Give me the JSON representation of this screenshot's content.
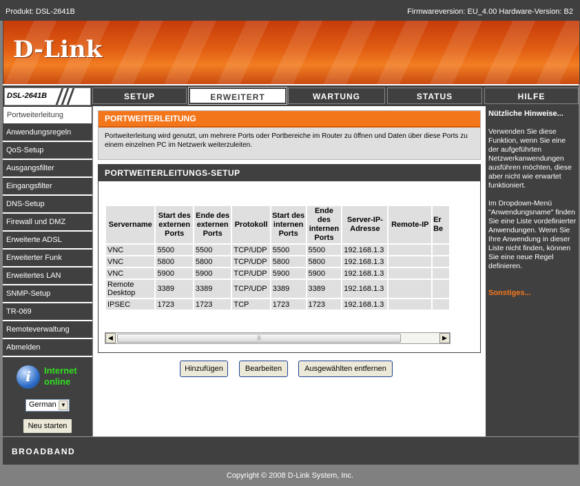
{
  "topbar": {
    "product": "Produkt: DSL-2641B",
    "firmware": "Firmwareversion: EU_4.00 Hardware-Version: B2"
  },
  "brand": {
    "logo": "D-Link",
    "model": "DSL-2641B",
    "footer": "BROADBAND",
    "copyright": "Copyright © 2008 D-Link System, Inc."
  },
  "tabs": [
    "SETUP",
    "ERWEITERT",
    "WARTUNG",
    "STATUS",
    "HILFE"
  ],
  "active_tab": "ERWEITERT",
  "sidebar": {
    "items": [
      "Portweiterleitung",
      "Anwendungsregeln",
      "QoS-Setup",
      "Ausgangsfilter",
      "Eingangsfilter",
      "DNS-Setup",
      "Firewall und DMZ",
      "Erweiterte ADSL",
      "Erweiterter Funk",
      "Erweitertes LAN",
      "SNMP-Setup",
      "TR-069",
      "Remoteverwaltung",
      "Abmelden"
    ],
    "status_icon": "i",
    "status_line1": "Internet",
    "status_line2": "online",
    "language": "German",
    "restart": "Neu starten"
  },
  "section1": {
    "title": "PORTWEITERLEITUNG",
    "description": "Portweiterleitung wird genutzt, um mehrere Ports oder Portbereiche im Router zu öffnen und Daten über diese Ports zu einem einzelnen PC im Netzwerk weiterzuleiten."
  },
  "section2": {
    "title": "PORTWEITERLEITUNGS-SETUP",
    "columns": [
      "Servername",
      "Start des externen Ports",
      "Ende des externen Ports",
      "Protokoll",
      "Start des internen Ports",
      "Ende des internen Ports",
      "Server-IP-Adresse",
      "Remote-IP",
      "Er Be"
    ],
    "rows": [
      [
        "VNC",
        "5500",
        "5500",
        "TCP/UDP",
        "5500",
        "5500",
        "192.168.1.3",
        "",
        ""
      ],
      [
        "VNC",
        "5800",
        "5800",
        "TCP/UDP",
        "5800",
        "5800",
        "192.168.1.3",
        "",
        ""
      ],
      [
        "VNC",
        "5900",
        "5900",
        "TCP/UDP",
        "5900",
        "5900",
        "192.168.1.3",
        "",
        ""
      ],
      [
        "Remote Desktop",
        "3389",
        "3389",
        "TCP/UDP",
        "3389",
        "3389",
        "192.168.1.3",
        "",
        ""
      ],
      [
        "IPSEC",
        "1723",
        "1723",
        "TCP",
        "1723",
        "1723",
        "192.168.1.3",
        "",
        ""
      ]
    ]
  },
  "buttons": {
    "add": "Hinzufügen",
    "edit": "Bearbeiten",
    "remove": "Ausgewählten entfernen"
  },
  "hints": {
    "title": "Nützliche Hinweise...",
    "p1": "Verwenden Sie diese Funktion, wenn Sie eine der aufgeführten Netzwerkanwendungen ausführen möchten, diese aber nicht wie erwartet funktioniert.",
    "p2": "Im Dropdown-Menü \"Anwendungsname\" finden Sie eine Liste vordefinierter Anwendungen. Wenn Sie Ihre Anwendung in dieser Liste nicht finden, können Sie eine neue Regel definieren.",
    "more": "Sonstiges..."
  }
}
